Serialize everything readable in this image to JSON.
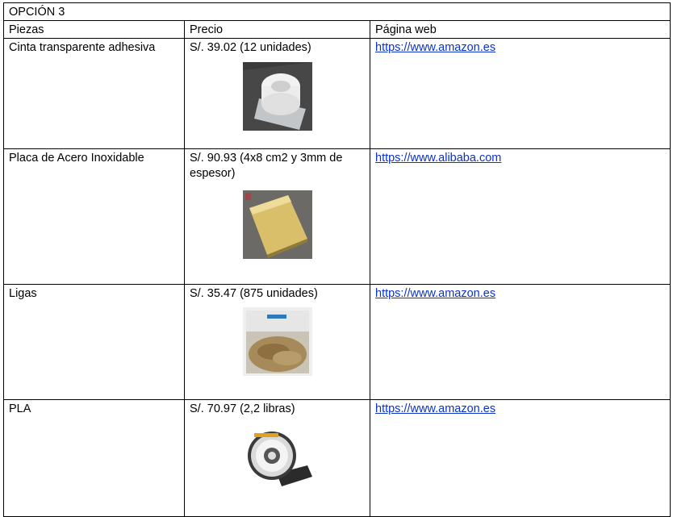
{
  "title": "OPCIÓN 3",
  "headers": [
    "Piezas",
    "Precio",
    "Página web"
  ],
  "rows": [
    {
      "pieza": "Cinta transparente adhesiva",
      "precio": "S/. 39.02 (12 unidades)",
      "web": "https://www.amazon.es",
      "image": "tape-roll-image"
    },
    {
      "pieza": "Placa de Acero Inoxidable",
      "precio": "S/. 90.93 (4x8 cm2 y 3mm de espesor)",
      "web": "https://www.alibaba.com",
      "image": "steel-plate-image"
    },
    {
      "pieza": "Ligas",
      "precio": "S/. 35.47 (875 unidades)",
      "web": "https://www.amazon.es",
      "image": "rubber-bands-image"
    },
    {
      "pieza": "PLA",
      "precio": "S/. 70.97 (2,2 libras)",
      "web": "https://www.amazon.es",
      "image": "pla-spool-image"
    }
  ]
}
